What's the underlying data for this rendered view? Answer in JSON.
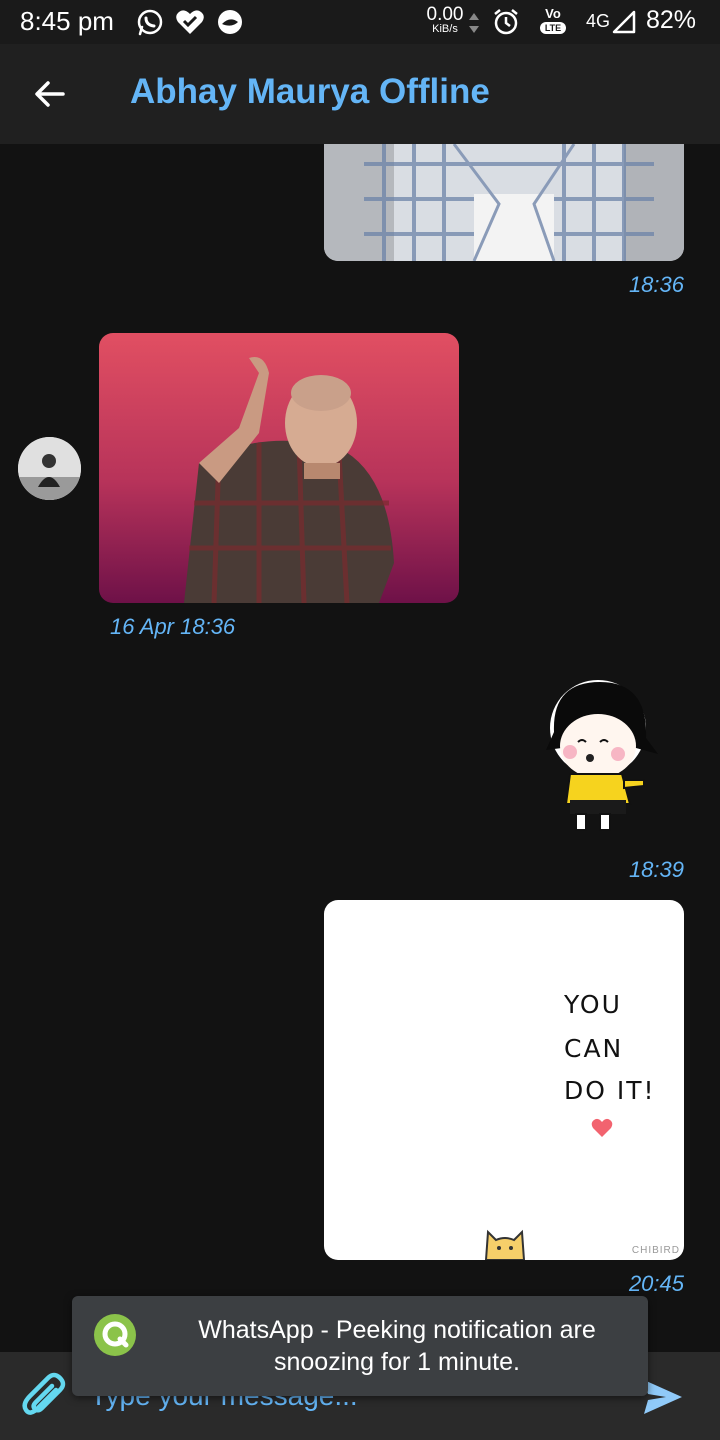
{
  "status_bar": {
    "time": "8:45 pm",
    "net_speed_value": "0.00",
    "net_speed_unit": "KiB/s",
    "volte_top": "Vo",
    "volte_bottom": "LTE",
    "network_type": "4G",
    "battery": "82%",
    "icons": [
      "whatsapp-icon",
      "heart-check-icon",
      "app-icon",
      "alarm-icon",
      "signal-icon"
    ]
  },
  "header": {
    "title": "Abhay Maurya Offline",
    "back_icon": "arrow-left-icon"
  },
  "messages": [
    {
      "side": "outgoing",
      "type": "image",
      "timestamp": "18:36"
    },
    {
      "side": "incoming",
      "type": "gif",
      "timestamp": "16 Apr 18:36"
    },
    {
      "side": "outgoing",
      "type": "sticker",
      "timestamp": "18:39"
    },
    {
      "side": "outgoing",
      "type": "image",
      "timestamp": "20:45",
      "card_lines": [
        "YOU",
        "CAN",
        "DO IT!"
      ],
      "card_credit": "CHIBIRD"
    }
  ],
  "input": {
    "placeholder": "Type your message...",
    "attach_icon": "paperclip-icon",
    "send_icon": "send-icon"
  },
  "toast": {
    "icon": "q-logo-icon",
    "text": "WhatsApp - Peeking notification are snoozing for 1 minute."
  },
  "colors": {
    "accent": "#64b5f6",
    "background": "#121212",
    "app_bar": "#202020",
    "toast_bg": "#3c3f42",
    "toast_icon": "#8bc34a"
  }
}
